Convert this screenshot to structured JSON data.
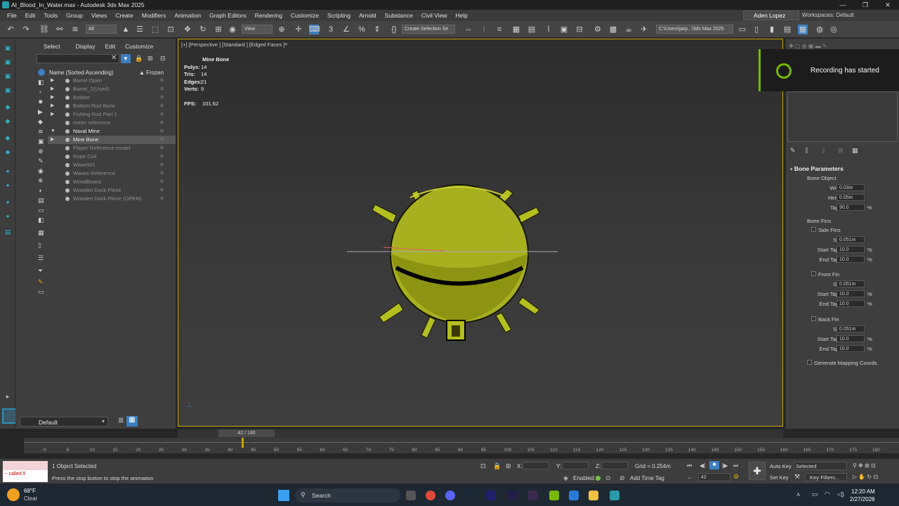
{
  "window": {
    "title": "AI_Blood_In_Water.max - Autodesk 3ds Max 2025",
    "controls": [
      "—",
      "❐",
      "✕"
    ]
  },
  "menu": [
    "File",
    "Edit",
    "Tools",
    "Group",
    "Views",
    "Create",
    "Modifiers",
    "Animation",
    "Graph Editors",
    "Rendering",
    "Customize",
    "Scripting",
    "Arnold",
    "Substance",
    "Civil View",
    "Help"
  ],
  "user": "Aden Lopez",
  "workspace": "Workspaces:  Default",
  "toolbar": {
    "filter_value": "All",
    "view_value": "View",
    "selection_set": "Create Selection Se",
    "path": "C:\\Users\\jarp...\\3ds Max 2025"
  },
  "explorer": {
    "tabs": [
      "Select",
      "Display",
      "Edit",
      "Customize"
    ],
    "header": "Name (Sorted Ascending)",
    "frozen_header": "▲ Frozen",
    "rows": [
      {
        "name": "Barrel Open",
        "state": "dim",
        "expand": "▶"
      },
      {
        "name": "Barrel_2(Used)",
        "state": "dim",
        "expand": "▶"
      },
      {
        "name": "Bobber",
        "state": "dim",
        "expand": "▶"
      },
      {
        "name": "Bottom Rod Bone",
        "state": "dim",
        "expand": "▶"
      },
      {
        "name": "Fishing Rod Part 1",
        "state": "dim",
        "expand": "▶"
      },
      {
        "name": "meter reference",
        "state": "dim",
        "expand": ""
      },
      {
        "name": "Naval Mine",
        "state": "active",
        "expand": "▼"
      },
      {
        "name": "Mine Bone",
        "state": "selected",
        "expand": "▶"
      },
      {
        "name": "Player Reference model",
        "state": "dim",
        "expand": ""
      },
      {
        "name": "Rope Coil",
        "state": "dim",
        "expand": ""
      },
      {
        "name": "Wave001",
        "state": "dim",
        "expand": ""
      },
      {
        "name": "Waves Reference",
        "state": "dim",
        "expand": ""
      },
      {
        "name": "WoodBoard",
        "state": "dim",
        "expand": ""
      },
      {
        "name": "Wooden Dock Piece",
        "state": "dim",
        "expand": ""
      },
      {
        "name": "Wooden Dock Piece (OPEN)",
        "state": "dim",
        "expand": ""
      }
    ],
    "layer": "Default"
  },
  "viewport": {
    "label": "[+] [Perspective ] [Standard ] [Edged Faces ]",
    "stats_title": "Mine Bone",
    "stats": [
      {
        "k": "Polys:",
        "v": "14"
      },
      {
        "k": "Tris:",
        "v": "14"
      },
      {
        "k": "Edges:",
        "v": "21"
      },
      {
        "k": "Verts:",
        "v": "9"
      }
    ],
    "fps_label": "FPS:",
    "fps_value": "101.62"
  },
  "notification": "Recording has started",
  "bone_params": {
    "title": "Bone Parameters",
    "object_group": "Bone Object",
    "width_label": "Width:",
    "width": "0.03m",
    "height_label": "Height:",
    "height": "0.05m",
    "taper_label": "Taper:",
    "taper": "90.0",
    "fins_group": "Bone Fins",
    "side_fins": "Side Fins",
    "front_fin": "Front Fin",
    "back_fin": "Back Fin",
    "size_label": "Size:",
    "start_label": "Start Taper:",
    "end_label": "End Taper:",
    "fin_size": "0.051m",
    "fin_taper": "10.0",
    "pct": "%",
    "mapping": "Generate Mapping Coords."
  },
  "timeline": {
    "slider": "42 / 180",
    "ticks": [
      "0",
      "5",
      "10",
      "15",
      "20",
      "25",
      "30",
      "35",
      "40",
      "45",
      "50",
      "55",
      "60",
      "65",
      "70",
      "75",
      "80",
      "85",
      "90",
      "95",
      "100",
      "105",
      "110",
      "115",
      "120",
      "125",
      "130",
      "135",
      "140",
      "145",
      "150",
      "155",
      "160",
      "165",
      "170",
      "175",
      "180"
    ]
  },
  "status": {
    "listener": "-- called fi",
    "selected": "1 Object Selected",
    "prompt": "Press the stop button to stop the animation",
    "x_label": "X:",
    "y_label": "Y:",
    "z_label": "Z:",
    "grid": "Grid = 0.254m",
    "enabled": "Enabled:",
    "add_time_tag": "Add Time Tag",
    "auto_key": "Auto Key",
    "set_key": "Set Key",
    "selected_dropdown": "Selected",
    "key_filters": "Key Filters...",
    "frame": "42"
  },
  "taskbar": {
    "weather_temp": "68°F",
    "weather_desc": "Clear",
    "search": "Search",
    "time": "12:20 AM",
    "date": "2/27/2026"
  }
}
